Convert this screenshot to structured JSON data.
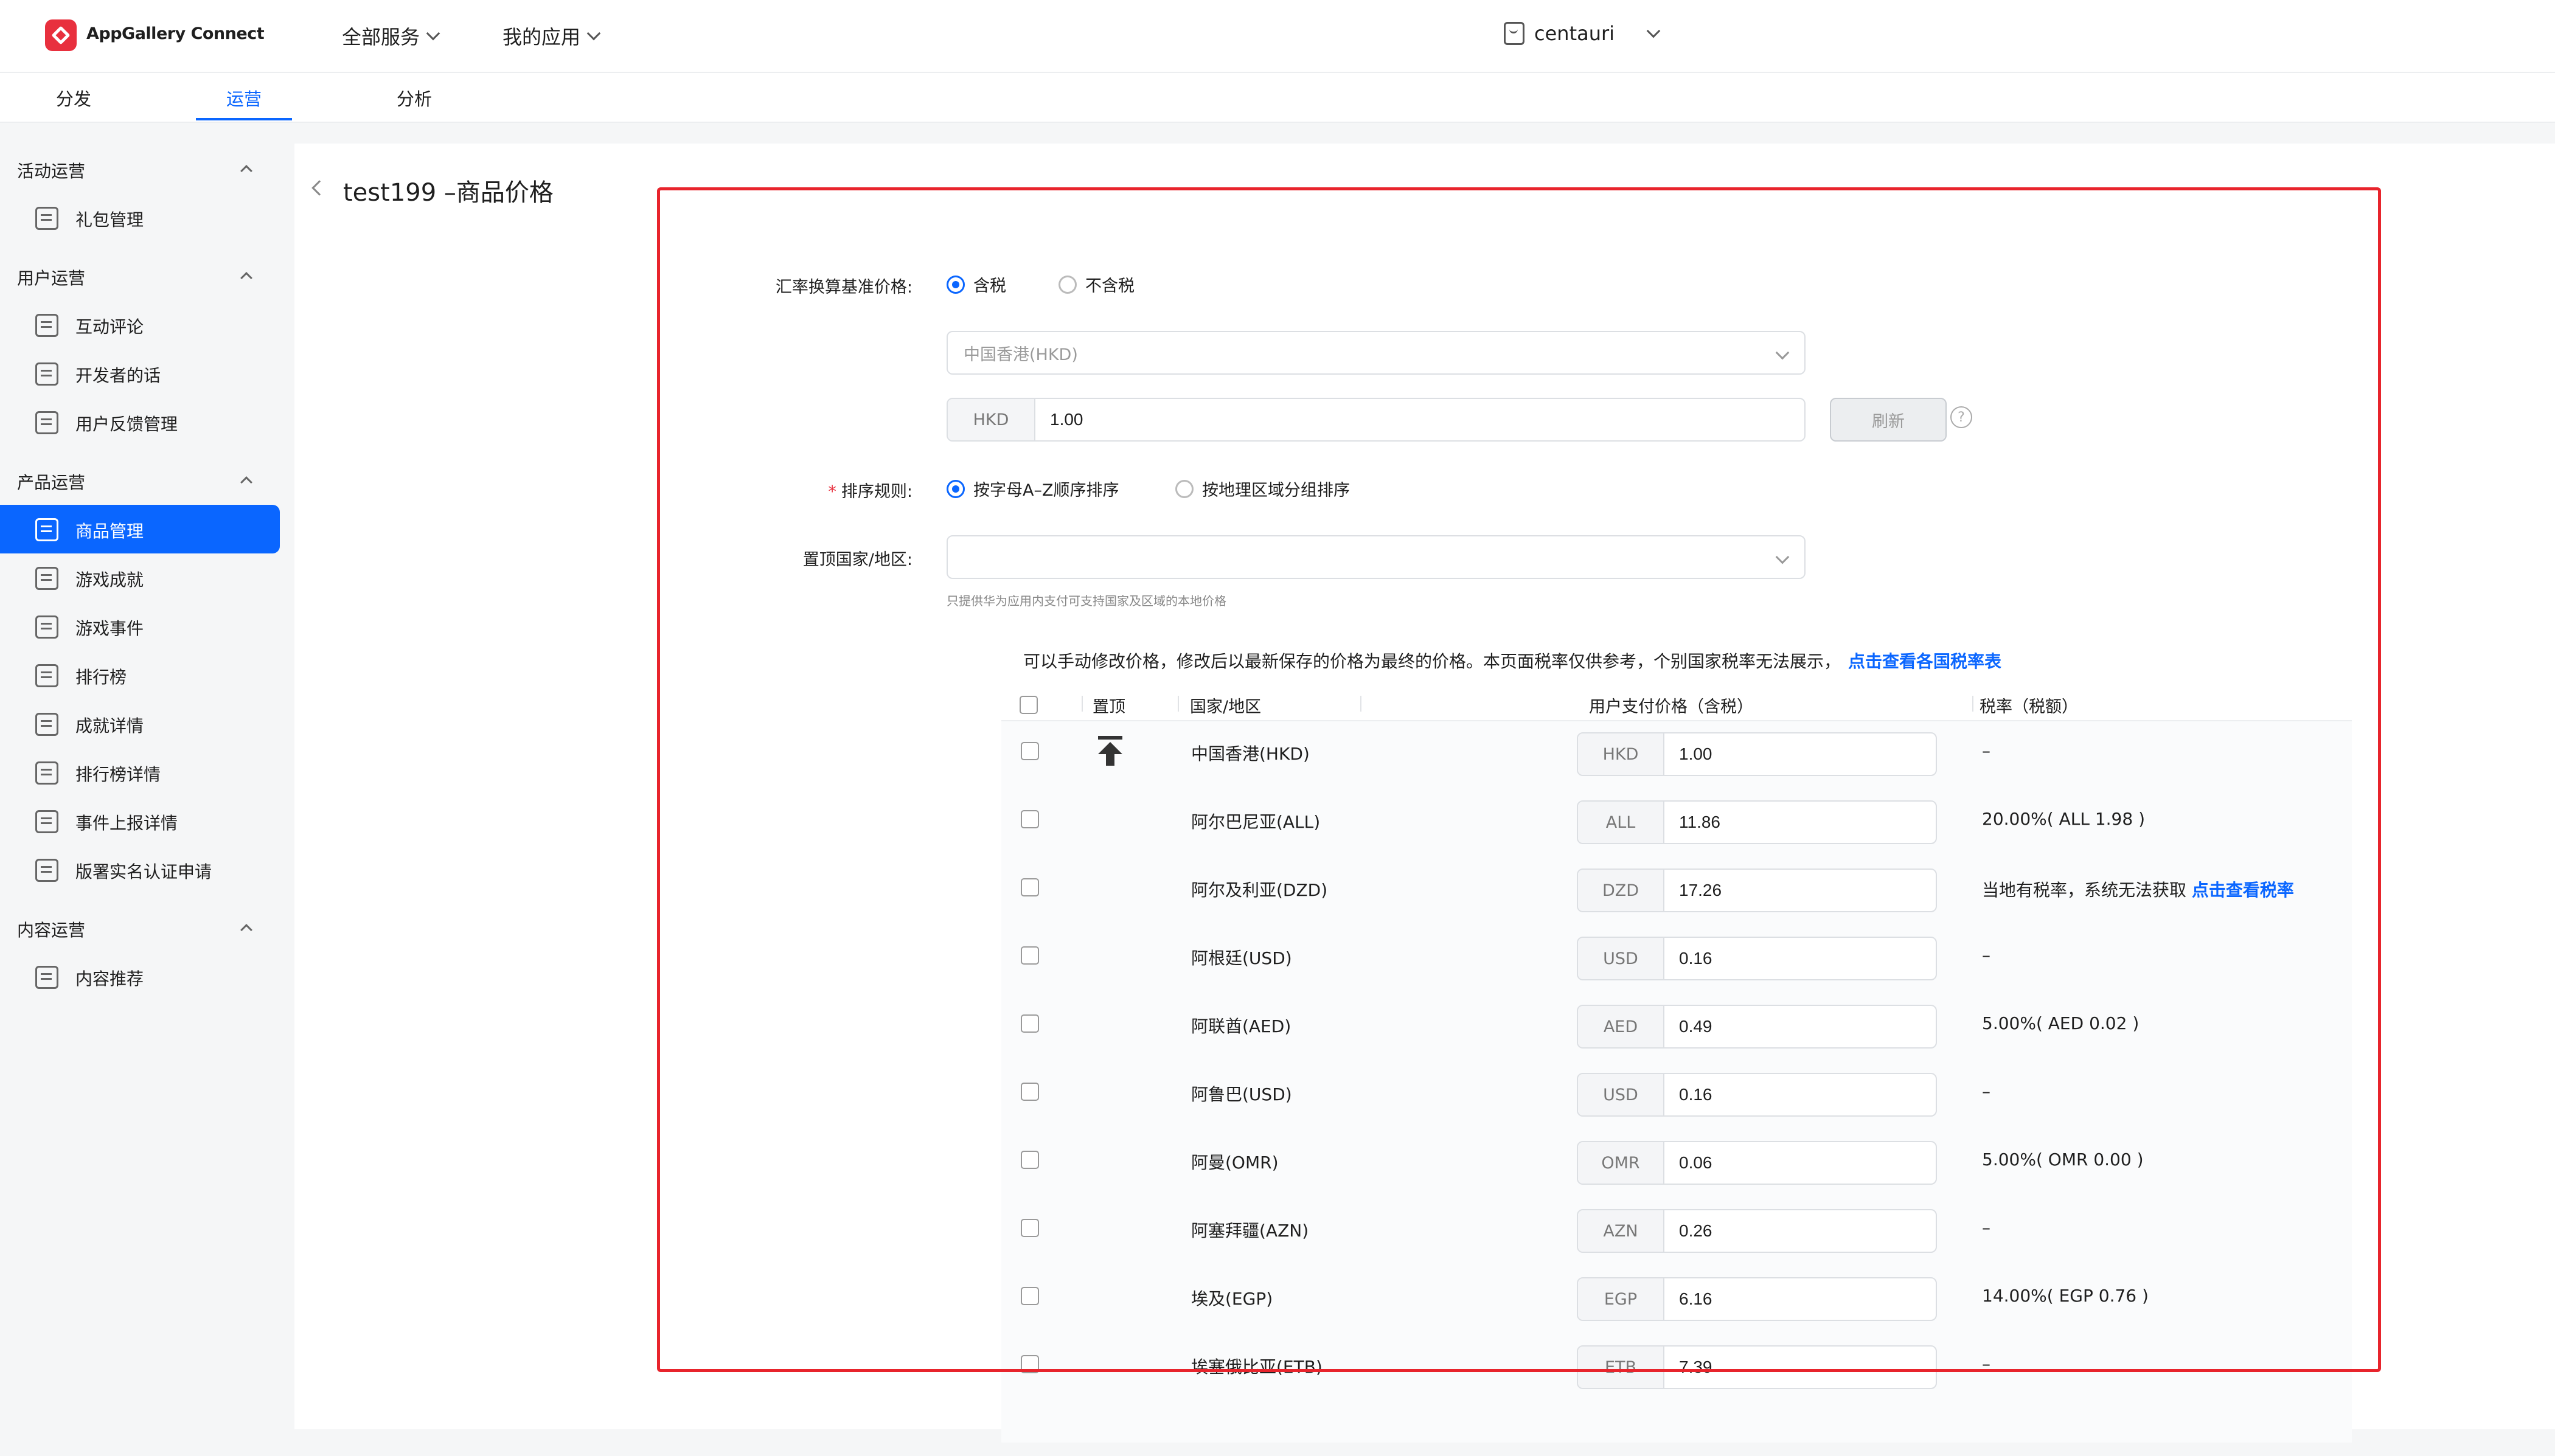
{
  "header": {
    "brand": "AppGallery Connect",
    "menu_all_services": "全部服务",
    "menu_my_apps": "我的应用",
    "account": "centauri"
  },
  "tabs": [
    "分发",
    "运营",
    "分析"
  ],
  "sidebar": {
    "groups": [
      {
        "title": "活动运营",
        "items": [
          "礼包管理"
        ]
      },
      {
        "title": "用户运营",
        "items": [
          "互动评论",
          "开发者的话",
          "用户反馈管理"
        ]
      },
      {
        "title": "产品运营",
        "items": [
          "商品管理",
          "游戏成就",
          "游戏事件",
          "排行榜",
          "成就详情",
          "排行榜详情",
          "事件上报详情",
          "版署实名认证申请"
        ]
      },
      {
        "title": "内容运营",
        "items": [
          "内容推荐"
        ]
      }
    ]
  },
  "page": {
    "title": "test199 –商品价格"
  },
  "form": {
    "base_price_label": "汇率换算基准价格:",
    "opt_tax_incl": "含税",
    "opt_tax_excl": "不含税",
    "region_select": "中国香港(HKD)",
    "rate_currency": "HKD",
    "rate_value": "1.00",
    "refresh_label": "刷新",
    "help_glyph": "?",
    "sort_label": "排序规则:",
    "required_mark": "*",
    "sort_opt_az": "按字母A–Z顺序排序",
    "sort_opt_region": "按地理区域分组排序",
    "pin_label": "置顶国家/地区:",
    "pin_placeholder": "",
    "hint": "只提供华为应用内支付可支持国家及区域的本地价格"
  },
  "notice": {
    "text": "可以手动修改价格，修改后以最新保存的价格为最终的价格。本页面税率仅供参考，个别国家税率无法展示，",
    "link": "点击查看各国税率表"
  },
  "table": {
    "headers": [
      "置顶",
      "国家/地区",
      "用户支付价格（含税）",
      "税率（税额）"
    ],
    "rows": [
      {
        "country": "中国香港(HKD)",
        "currency": "HKD",
        "price": "1.00",
        "tax": "–",
        "tax_link": ""
      },
      {
        "country": "阿尔巴尼亚(ALL)",
        "currency": "ALL",
        "price": "11.86",
        "tax": "20.00%( ALL 1.98 )",
        "tax_link": ""
      },
      {
        "country": "阿尔及利亚(DZD)",
        "currency": "DZD",
        "price": "17.26",
        "tax": "当地有税率，系统无法获取 ",
        "tax_link": "点击查看税率"
      },
      {
        "country": "阿根廷(USD)",
        "currency": "USD",
        "price": "0.16",
        "tax": "–",
        "tax_link": ""
      },
      {
        "country": "阿联酋(AED)",
        "currency": "AED",
        "price": "0.49",
        "tax": "5.00%( AED 0.02 )",
        "tax_link": ""
      },
      {
        "country": "阿鲁巴(USD)",
        "currency": "USD",
        "price": "0.16",
        "tax": "–",
        "tax_link": ""
      },
      {
        "country": "阿曼(OMR)",
        "currency": "OMR",
        "price": "0.06",
        "tax": "5.00%( OMR 0.00 )",
        "tax_link": ""
      },
      {
        "country": "阿塞拜疆(AZN)",
        "currency": "AZN",
        "price": "0.26",
        "tax": "–",
        "tax_link": ""
      },
      {
        "country": "埃及(EGP)",
        "currency": "EGP",
        "price": "6.16",
        "tax": "14.00%( EGP 0.76 )",
        "tax_link": ""
      },
      {
        "country": "埃塞俄比亚(ETB)",
        "currency": "ETB",
        "price": "7.39",
        "tax": "–",
        "tax_link": ""
      }
    ]
  },
  "colors": {
    "accent": "#0a66ff",
    "brand_red": "#e8303e",
    "highlight_red": "#e8242c"
  }
}
